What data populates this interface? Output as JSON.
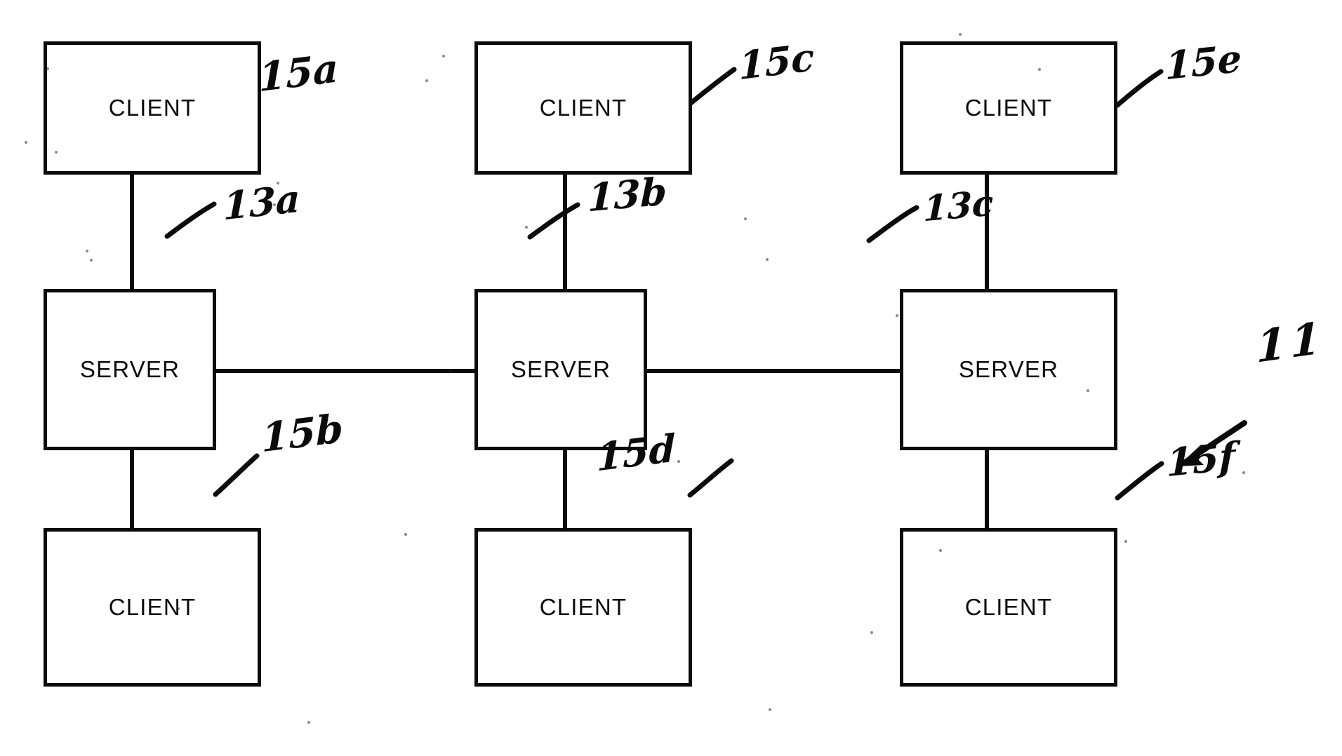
{
  "figure": {
    "kind": "patent-block-diagram",
    "ink_color": "#0b0b0b",
    "background_color": "#ffffff",
    "system_reference": "11"
  },
  "nodes": [
    {
      "id": "client_15a",
      "label": "CLIENT",
      "column": 1,
      "row": "top",
      "ref": "15a"
    },
    {
      "id": "client_15c",
      "label": "CLIENT",
      "column": 2,
      "row": "top",
      "ref": "15c"
    },
    {
      "id": "client_15e",
      "label": "CLIENT",
      "column": 3,
      "row": "top",
      "ref": "15e"
    },
    {
      "id": "server_13a",
      "label": "SERVER",
      "column": 1,
      "row": "middle",
      "ref": "13a"
    },
    {
      "id": "server_13b",
      "label": "SERVER",
      "column": 2,
      "row": "middle",
      "ref": "13b"
    },
    {
      "id": "server_13c",
      "label": "SERVER",
      "column": 3,
      "row": "middle",
      "ref": "13c"
    },
    {
      "id": "client_15b",
      "label": "CLIENT",
      "column": 1,
      "row": "bottom",
      "ref": "15b"
    },
    {
      "id": "client_15d",
      "label": "CLIENT",
      "column": 2,
      "row": "bottom",
      "ref": "15d"
    },
    {
      "id": "client_15f",
      "label": "CLIENT",
      "column": 3,
      "row": "bottom",
      "ref": "15f"
    }
  ],
  "labels": {
    "client_top_left": "CLIENT",
    "client_top_mid": "CLIENT",
    "client_top_right": "CLIENT",
    "server_left": "SERVER",
    "server_mid": "SERVER",
    "server_right": "SERVER",
    "client_bot_left": "CLIENT",
    "client_bot_mid": "CLIENT",
    "client_bot_right": "CLIENT"
  },
  "refs": {
    "r15a": "15a",
    "r15c": "15c",
    "r15e": "15e",
    "r13a": "13a",
    "r13b": "13b",
    "r13c": "13c",
    "r15b": "15b",
    "r15d": "15d",
    "r15f": "15f",
    "r11": "11"
  },
  "connections": [
    {
      "from": "client_15a",
      "to": "server_13a",
      "type": "vertical"
    },
    {
      "from": "client_15c",
      "to": "server_13b",
      "type": "vertical"
    },
    {
      "from": "client_15e",
      "to": "server_13c",
      "type": "vertical"
    },
    {
      "from": "server_13a",
      "to": "client_15b",
      "type": "vertical"
    },
    {
      "from": "server_13b",
      "to": "client_15d",
      "type": "vertical"
    },
    {
      "from": "server_13c",
      "to": "client_15f",
      "type": "vertical"
    },
    {
      "from": "server_13a",
      "to": "server_13b",
      "type": "horizontal"
    },
    {
      "from": "server_13b",
      "to": "server_13c",
      "type": "horizontal"
    }
  ]
}
